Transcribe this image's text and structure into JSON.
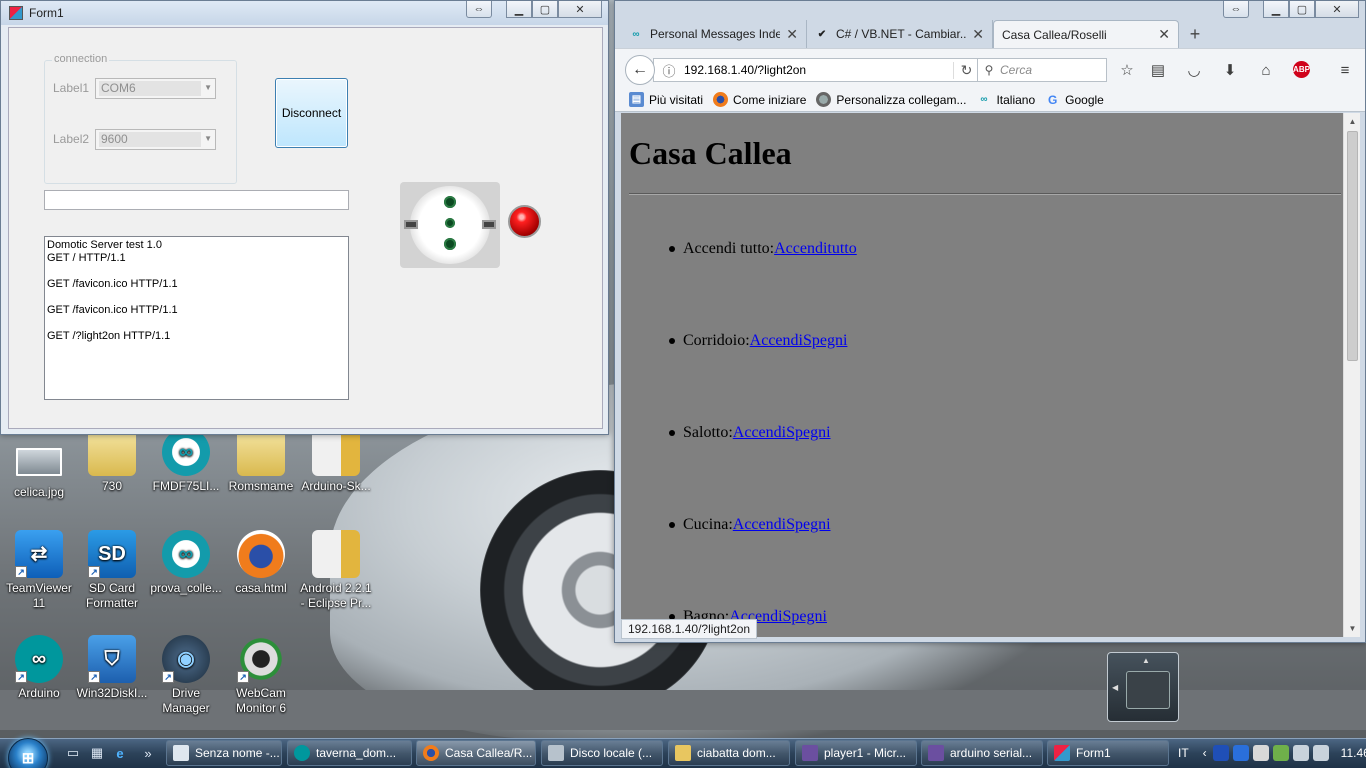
{
  "desktop": {
    "icons": [
      {
        "label": "celica.jpg",
        "icon": "image-icon"
      },
      {
        "label": "730",
        "icon": "folder-icon"
      },
      {
        "label": "FMDF75LI...",
        "icon": "arduino-icon"
      },
      {
        "label": "Romsmame",
        "icon": "folder-icon"
      },
      {
        "label": "Arduino-Sk...",
        "icon": "zip-icon"
      },
      {
        "label": "TeamViewer 11",
        "icon": "teamviewer-icon"
      },
      {
        "label": "SD Card Formatter",
        "icon": "sd-card-icon"
      },
      {
        "label": "prova_colle...",
        "icon": "arduino-icon"
      },
      {
        "label": "casa.html",
        "icon": "firefox-icon"
      },
      {
        "label": "Android 2.2.1 - Eclipse Pr...",
        "icon": "zip-icon"
      },
      {
        "label": "Arduino",
        "icon": "arduino-icon"
      },
      {
        "label": "Win32DiskI...",
        "icon": "disk-imager-icon"
      },
      {
        "label": "Drive Manager",
        "icon": "drive-icon"
      },
      {
        "label": "WebCam Monitor 6",
        "icon": "webcam-icon"
      }
    ]
  },
  "form1": {
    "title": "Form1",
    "groupbox": "connection",
    "label1": "Label1",
    "label2": "Label2",
    "combo1": "COM6",
    "combo2": "9600",
    "disconnect": "Disconnect",
    "log": [
      "Domotic Server test 1.0",
      "GET / HTTP/1.1",
      "",
      "GET /favicon.ico HTTP/1.1",
      "",
      "GET /favicon.ico HTTP/1.1",
      "",
      "GET /?light2on HTTP/1.1"
    ]
  },
  "browser": {
    "tabs": [
      {
        "label": "Personal Messages Index",
        "icon": "arduino-icon"
      },
      {
        "label": "C# / VB.NET - Cambiar...",
        "icon": "site-icon"
      },
      {
        "label": "Casa Callea/Roselli",
        "icon": ""
      }
    ],
    "url": "192.168.1.40/?light2on",
    "search_placeholder": "Cerca",
    "abp": "ABP",
    "bookmarks": [
      {
        "label": "Più visitati",
        "icon": "bookmarks-icon"
      },
      {
        "label": "Come iniziare",
        "icon": "firefox-icon"
      },
      {
        "label": "Personalizza collegam...",
        "icon": "globe-icon"
      },
      {
        "label": "Italiano",
        "icon": "arduino-icon"
      },
      {
        "label": "Google",
        "icon": "google-icon"
      }
    ],
    "page": {
      "heading": "Casa Callea",
      "items": [
        {
          "label": "Accendi tutto:",
          "link": "Accenditutto"
        },
        {
          "label": "Corridoio:",
          "link": "AccendiSpegni"
        },
        {
          "label": "Salotto:",
          "link": "AccendiSpegni"
        },
        {
          "label": "Cucina:",
          "link": "AccendiSpegni"
        },
        {
          "label": "Bagno:",
          "link": "AccendiSpegni"
        }
      ]
    },
    "status_url": "192.168.1.40/?light2on"
  },
  "taskbar": {
    "buttons": [
      {
        "label": "Senza nome -..."
      },
      {
        "label": "taverna_dom..."
      },
      {
        "label": "Casa Callea/R..."
      },
      {
        "label": "Disco locale (..."
      },
      {
        "label": "ciabatta dom..."
      },
      {
        "label": "player1 - Micr..."
      },
      {
        "label": "arduino serial..."
      },
      {
        "label": "Form1"
      }
    ],
    "language": "IT",
    "clock": "11.46"
  }
}
